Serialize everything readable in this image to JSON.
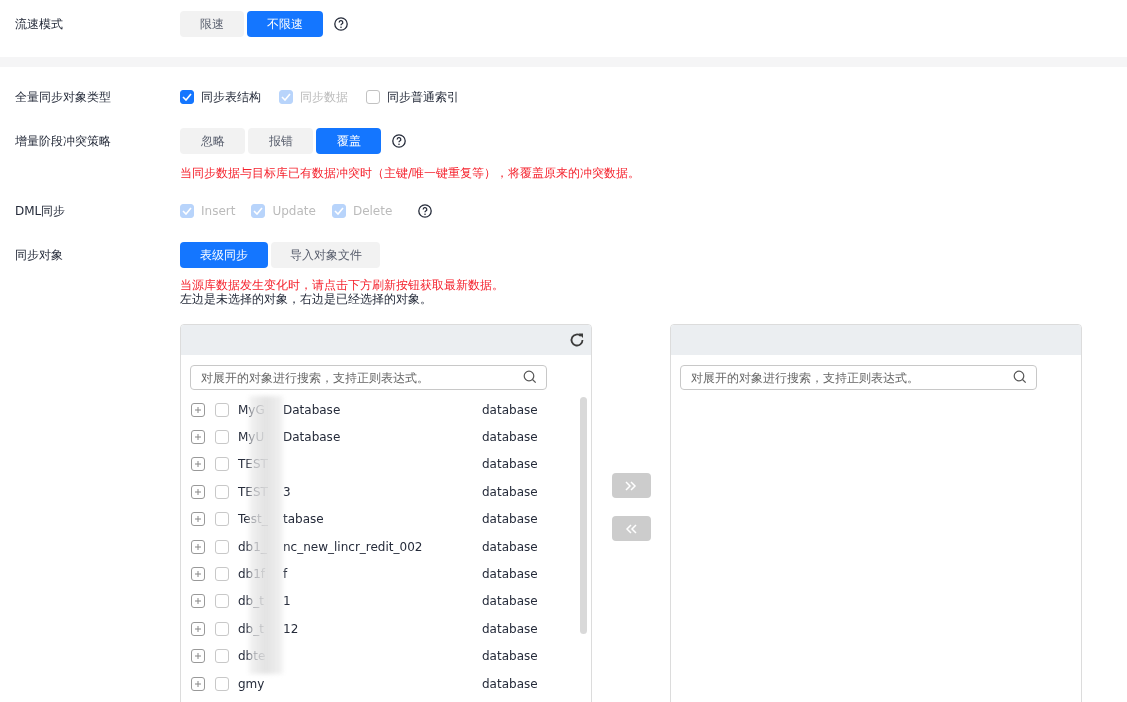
{
  "flow_mode": {
    "label": "流速模式",
    "options": [
      {
        "label": "限速",
        "selected": false
      },
      {
        "label": "不限速",
        "selected": true
      }
    ]
  },
  "full_sync_types": {
    "label": "全量同步对象类型",
    "options": [
      {
        "label": "同步表结构",
        "checked": true,
        "disabled": false
      },
      {
        "label": "同步数据",
        "checked": true,
        "disabled": true
      },
      {
        "label": "同步普通索引",
        "checked": false,
        "disabled": false
      }
    ]
  },
  "conflict_policy": {
    "label": "增量阶段冲突策略",
    "options": [
      {
        "label": "忽略",
        "selected": false
      },
      {
        "label": "报错",
        "selected": false
      },
      {
        "label": "覆盖",
        "selected": true
      }
    ],
    "warning": "当同步数据与目标库已有数据冲突时（主键/唯一键重复等），将覆盖原来的冲突数据。"
  },
  "dml_sync": {
    "label": "DML同步",
    "options": [
      {
        "label": "Insert",
        "checked": true,
        "disabled": true
      },
      {
        "label": "Update",
        "checked": true,
        "disabled": true
      },
      {
        "label": "Delete",
        "checked": true,
        "disabled": true
      }
    ]
  },
  "sync_objects": {
    "label": "同步对象",
    "options": [
      {
        "label": "表级同步",
        "selected": true
      },
      {
        "label": "导入对象文件",
        "selected": false
      }
    ],
    "warning": "当源库数据发生变化时，请点击下方刷新按钮获取最新数据。",
    "hint": "左边是未选择的对象，右边是已经选择的对象。"
  },
  "source_panel": {
    "search": {
      "placeholder": "对展开的对象进行搜索，支持正则表达式。"
    },
    "items": [
      {
        "name_parts": [
          "MyG",
          "Database"
        ],
        "type": "database",
        "checked": false
      },
      {
        "name_parts": [
          "MyU",
          "Database"
        ],
        "type": "database",
        "checked": false
      },
      {
        "name_parts": [
          "TEST"
        ],
        "type": "database",
        "checked": false
      },
      {
        "name_parts": [
          "TEST",
          "3"
        ],
        "type": "database",
        "checked": false
      },
      {
        "name_parts": [
          "Test_",
          "tabase"
        ],
        "type": "database",
        "checked": false
      },
      {
        "name_parts": [
          "db1_",
          "nc_new_lincr_redit_002"
        ],
        "type": "database",
        "checked": false
      },
      {
        "name_parts": [
          "db1f",
          "f"
        ],
        "type": "database",
        "checked": false
      },
      {
        "name_parts": [
          "db_t",
          "1"
        ],
        "type": "database",
        "checked": false
      },
      {
        "name_parts": [
          "db_t",
          "12"
        ],
        "type": "database",
        "checked": false
      },
      {
        "name_parts": [
          "dbte"
        ],
        "type": "database",
        "checked": false
      },
      {
        "name_parts": [
          "gmy"
        ],
        "type": "database",
        "checked": false
      }
    ]
  },
  "target_panel": {
    "search": {
      "placeholder": "对展开的对象进行搜索，支持正则表达式。"
    }
  }
}
